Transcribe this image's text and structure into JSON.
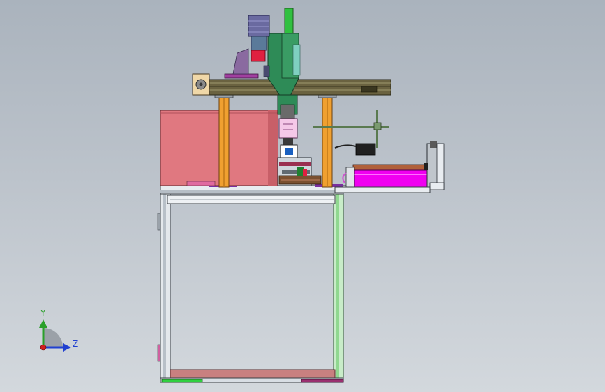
{
  "viewport": {
    "background_top": "#aab3bd",
    "background_bottom": "#d3d8dd"
  },
  "model": {
    "parts": [
      "stepper-motor",
      "vertical-slide-rail",
      "gantry-beam",
      "support-column-left",
      "support-column-right",
      "pink-enclosure",
      "work-table",
      "base-frame",
      "pneumatic-cylinder",
      "camera-sensor",
      "sensor-bracket",
      "rotary-fixture"
    ],
    "colors": {
      "frame": "#d8dee4",
      "frame_edge": "#3a3f45",
      "column": "#f0a030",
      "enclosure": "#e07880",
      "cylinder": "#f000f0",
      "slide": "#2e8b57",
      "motor": "#6a6aa0",
      "accent_green": "#30c040"
    }
  },
  "triad": {
    "y_label": "Y",
    "z_label": "Z",
    "y_color": "#2aa02a",
    "z_color": "#2040d0",
    "origin_color": "#d02020"
  }
}
